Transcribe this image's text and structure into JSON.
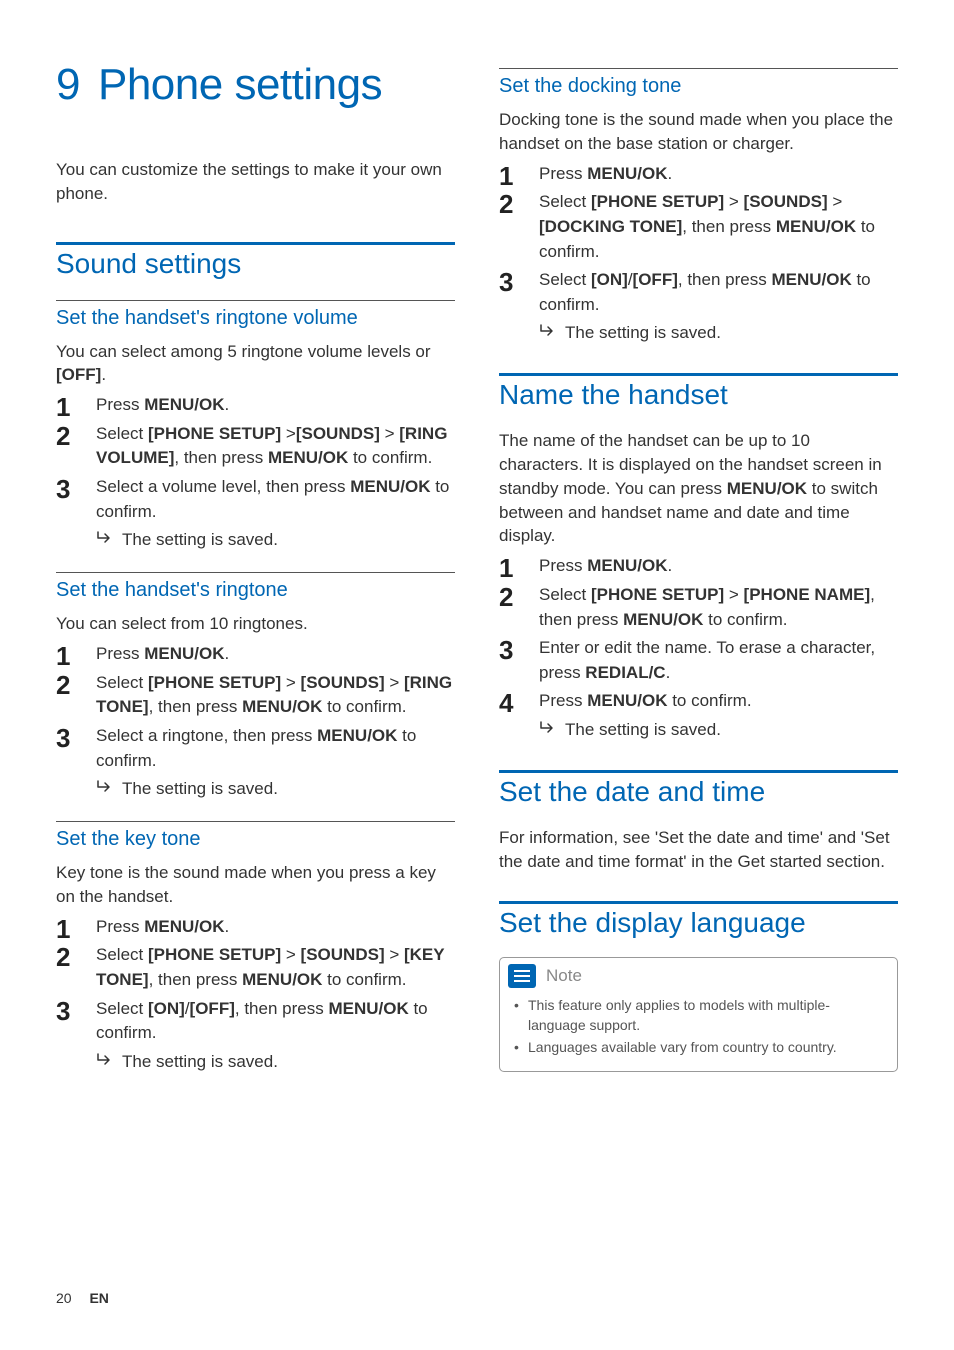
{
  "chapter": {
    "number": "9",
    "title": "Phone settings"
  },
  "intro": "You can customize the settings to make it your own phone.",
  "left": {
    "section1": {
      "title": "Sound settings"
    },
    "sub1": {
      "title": "Set the handset's ringtone volume",
      "intro_a": "You can select among 5 ringtone volume levels or ",
      "intro_b": "[OFF]",
      "intro_c": ".",
      "step1_a": "Press ",
      "step1_b": "MENU/OK",
      "step1_c": ".",
      "step2_a": "Select ",
      "step2_b": "[PHONE SETUP]",
      "step2_c": " >",
      "step2_d": "[SOUNDS]",
      "step2_e": " > ",
      "step2_f": "[RING VOLUME]",
      "step2_g": ", then press ",
      "step2_h": "MENU/OK",
      "step2_i": " to confirm.",
      "step3_a": "Select a volume level, then press ",
      "step3_b": "MENU/OK",
      "step3_c": " to confirm.",
      "result": "The setting is saved."
    },
    "sub2": {
      "title": "Set the handset's ringtone",
      "intro": "You can select from 10 ringtones.",
      "step1_a": "Press ",
      "step1_b": "MENU/OK",
      "step1_c": ".",
      "step2_a": "Select ",
      "step2_b": "[PHONE SETUP]",
      "step2_c": " > ",
      "step2_d": "[SOUNDS]",
      "step2_e": " > ",
      "step2_f": "[RING TONE]",
      "step2_g": ", then press ",
      "step2_h": "MENU/OK",
      "step2_i": " to confirm.",
      "step3_a": "Select a ringtone, then press ",
      "step3_b": "MENU/OK",
      "step3_c": " to confirm.",
      "result": "The setting is saved."
    },
    "sub3": {
      "title": "Set the key tone",
      "intro": "Key tone is the sound made when you press a key on the handset.",
      "step1_a": "Press ",
      "step1_b": "MENU/OK",
      "step1_c": ".",
      "step2_a": "Select ",
      "step2_b": "[PHONE SETUP]",
      "step2_c": " > ",
      "step2_d": "[SOUNDS]",
      "step2_e": " > ",
      "step2_f": "[KEY TONE]",
      "step2_g": ", then press ",
      "step2_h": "MENU/OK",
      "step2_i": " to confirm.",
      "step3_a": "Select ",
      "step3_b": "[ON]",
      "step3_c": "/",
      "step3_d": "[OFF]",
      "step3_e": ", then press ",
      "step3_f": "MENU/OK",
      "step3_g": " to confirm.",
      "result": "The setting is saved."
    }
  },
  "right": {
    "sub4": {
      "title": "Set the docking tone",
      "intro": "Docking tone is the sound made when you place the handset on the base station or charger.",
      "step1_a": "Press ",
      "step1_b": "MENU/OK",
      "step1_c": ".",
      "step2_a": "Select ",
      "step2_b": "[PHONE SETUP]",
      "step2_c": " > ",
      "step2_d": "[SOUNDS]",
      "step2_e": " > ",
      "step2_f": "[DOCKING TONE]",
      "step2_g": ", then press ",
      "step2_h": "MENU/OK",
      "step2_i": " to confirm.",
      "step3_a": "Select ",
      "step3_b": "[ON]",
      "step3_c": "/",
      "step3_d": "[OFF]",
      "step3_e": ", then press ",
      "step3_f": "MENU/OK",
      "step3_g": " to confirm.",
      "result": "The setting is saved."
    },
    "section2": {
      "title": "Name the handset",
      "intro_a": "The name of the handset can be up to 10 characters. It is displayed on the handset screen in standby mode. You can press ",
      "intro_b": "MENU/OK",
      "intro_c": " to switch between and handset name and date and time display.",
      "step1_a": "Press ",
      "step1_b": "MENU/OK",
      "step1_c": ".",
      "step2_a": "Select ",
      "step2_b": "[PHONE SETUP]",
      "step2_c": " > ",
      "step2_d": "[PHONE NAME]",
      "step2_e": ", then press ",
      "step2_f": "MENU/OK",
      "step2_g": " to confirm.",
      "step3_a": "Enter or edit the name. To erase a character, press ",
      "step3_b": "REDIAL/C",
      "step3_c": ".",
      "step4_a": "Press ",
      "step4_b": "MENU/OK",
      "step4_c": " to confirm.",
      "result": "The setting is saved."
    },
    "section3": {
      "title": "Set the date and time",
      "intro": "For information, see 'Set the date and time' and 'Set the date and time format' in the Get started section."
    },
    "section4": {
      "title": "Set the display language",
      "note_label": "Note",
      "note1": "This feature only applies to models with multiple-language support.",
      "note2": "Languages available vary from country to country."
    }
  },
  "footer": {
    "page": "20",
    "lang": "EN"
  }
}
